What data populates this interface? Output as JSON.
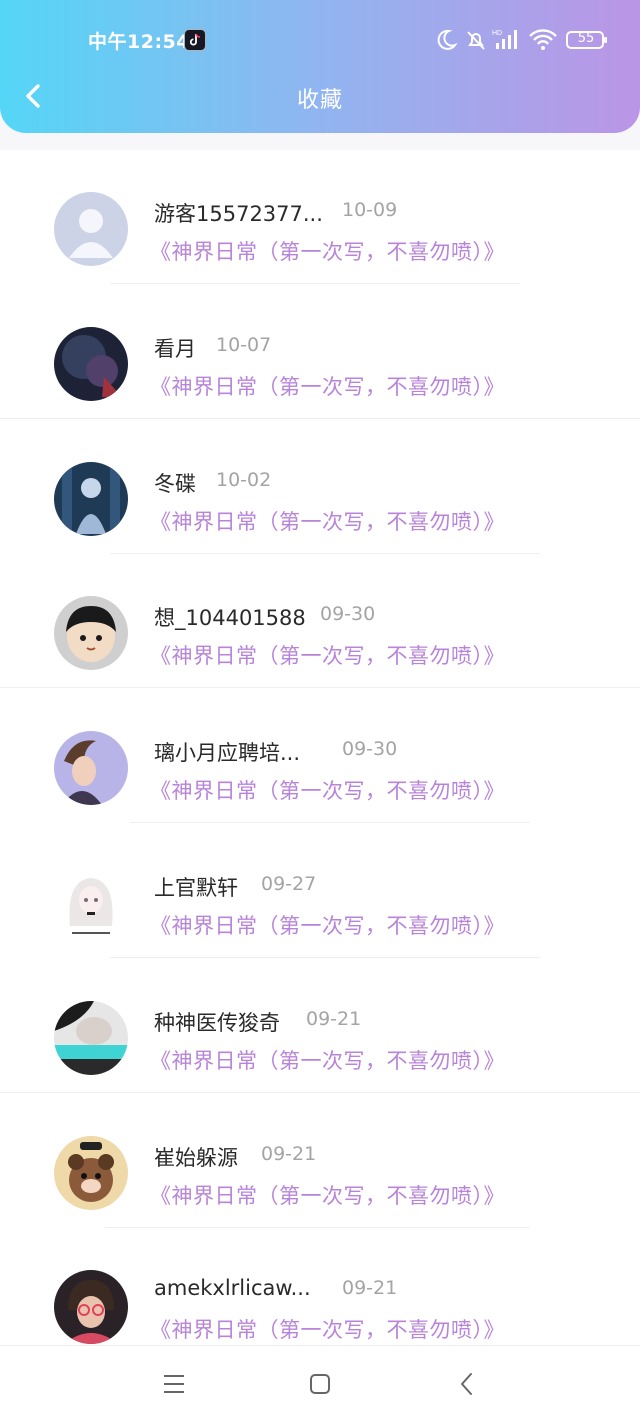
{
  "status_bar": {
    "time": "中午12:54",
    "battery": "55"
  },
  "header": {
    "title": "收藏"
  },
  "items": [
    {
      "name": "游客15572377...",
      "date": "10-09",
      "book": "《神界日常（第一次写，不喜勿喷）》"
    },
    {
      "name": "看月",
      "date": "10-07",
      "book": "《神界日常（第一次写，不喜勿喷）》"
    },
    {
      "name": "冬碟",
      "date": "10-02",
      "book": "《神界日常（第一次写，不喜勿喷）》"
    },
    {
      "name": "想_104401588",
      "date": "09-30",
      "book": "《神界日常（第一次写，不喜勿喷）》"
    },
    {
      "name": "璃小月应聘培...",
      "date": "09-30",
      "book": "《神界日常（第一次写，不喜勿喷）》"
    },
    {
      "name": "上官默轩",
      "date": "09-27",
      "book": "《神界日常（第一次写，不喜勿喷）》"
    },
    {
      "name": "种神医传狻奇",
      "date": "09-21",
      "book": "《神界日常（第一次写，不喜勿喷）》"
    },
    {
      "name": "崔始躲源",
      "date": "09-21",
      "book": "《神界日常（第一次写，不喜勿喷）》"
    },
    {
      "name": "amekxlrlicaw...",
      "date": "09-21",
      "book": "《神界日常（第一次写，不喜勿喷）》"
    }
  ]
}
